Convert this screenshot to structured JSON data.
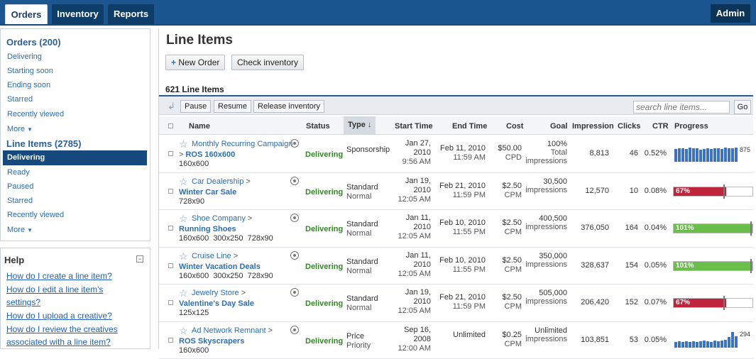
{
  "nav": {
    "tabs": [
      "Orders",
      "Inventory",
      "Reports"
    ],
    "admin": "Admin"
  },
  "sidebar": {
    "orders_header": "Orders (200)",
    "orders_items": [
      "Delivering",
      "Starting soon",
      "Ending soon",
      "Starred",
      "Recently viewed",
      "More"
    ],
    "line_items_header": "Line Items (2785)",
    "line_items_items": [
      "Delivering",
      "Ready",
      "Paused",
      "Starred",
      "Recently viewed",
      "More"
    ],
    "selected": "Delivering"
  },
  "help": {
    "title": "Help",
    "collapse": "−",
    "questions": [
      "How do I create a line item?",
      "How do I edit a line item's",
      "settings?",
      "How do I upload a creative?",
      "How do I review the creatives",
      "associated with a line item?"
    ]
  },
  "main": {
    "title": "Line Items",
    "new_order": "New Order",
    "new_order_icon": "+",
    "check_inventory": "Check inventory",
    "count_label": "621 Line Items",
    "toolbar": {
      "pause": "Pause",
      "resume": "Resume",
      "release": "Release inventory",
      "search_placeholder": "search line items...",
      "go": "Go"
    },
    "columns": {
      "name": "Name",
      "status": "Status",
      "type": "Type ↓",
      "start": "Start Time",
      "end": "End Time",
      "cost": "Cost",
      "goal": "Goal",
      "impression": "Impression",
      "clicks": "Clicks",
      "ctr": "CTR",
      "progress": "Progress"
    }
  },
  "rows": [
    {
      "advertiser": "Monthly Recurring Campaign",
      "prefix": "> ",
      "name": "ROS 160x600",
      "sizes": "160x600",
      "status": "Delivering",
      "type1": "Sponsorship",
      "type2": "",
      "start1": "Jan 27,",
      "start2": "2010",
      "start3": "9:56 AM",
      "end1": "Feb 11, 2010",
      "end2": "11:59 AM",
      "cost1": "$50.00",
      "cost2": "CPD",
      "goal1": "100%",
      "goal2": "Total",
      "goal3": "impressions",
      "impressions": "8,813",
      "clicks": "46",
      "ctr": "0.52%",
      "progress": {
        "kind": "spark",
        "label": "875",
        "bars": [
          0.75,
          0.8,
          0.8,
          0.75,
          0.85,
          0.8,
          0.8,
          0.7,
          0.75,
          0.8,
          0.75,
          0.8,
          0.8,
          0.75,
          0.85,
          0.8,
          0.8,
          0.85
        ]
      }
    },
    {
      "advertiser": "Car Dealership",
      "prefix": "",
      "advertiser_suffix": " >",
      "name": "Winter Car Sale",
      "sizes": "728x90",
      "status": "Delivering",
      "type1": "Standard",
      "type2": "Normal",
      "start1": "Jan 19,",
      "start2": "2010",
      "start3": "12:05 AM",
      "end1": "Feb 21, 2010",
      "end2": "11:59 PM",
      "cost1": "$2.50",
      "cost2": "CPM",
      "goal1": "30,500",
      "goal2": "impressions",
      "goal3": "",
      "impressions": "12,570",
      "clicks": "10",
      "ctr": "0.08%",
      "progress": {
        "kind": "bar",
        "label": "67%",
        "value": 0.67,
        "mark": 0.63,
        "color": "#c0243c"
      }
    },
    {
      "advertiser": "Shoe Company",
      "prefix": "",
      "advertiser_suffix": " >",
      "name": "Running Shoes",
      "sizes": "160x600  300x250  728x90",
      "status": "Delivering",
      "type1": "Standard",
      "type2": "Normal",
      "start1": "Jan 11,",
      "start2": "2010",
      "start3": "12:05 AM",
      "end1": "Feb 10, 2010",
      "end2": "11:55 PM",
      "cost1": "$2.50",
      "cost2": "CPM",
      "goal1": "400,500",
      "goal2": "impressions",
      "goal3": "",
      "impressions": "376,050",
      "clicks": "164",
      "ctr": "0.04%",
      "progress": {
        "kind": "bar",
        "label": "101%",
        "value": 1.0,
        "mark": 0.97,
        "color": "#6abf4b"
      }
    },
    {
      "advertiser": "Cruise Line",
      "prefix": "",
      "advertiser_suffix": " >",
      "name": "Winter Vacation Deals",
      "sizes": "160x600  300x250  728x90",
      "status": "Delivering",
      "type1": "Standard",
      "type2": "Normal",
      "start1": "Jan 11,",
      "start2": "2010",
      "start3": "12:05 AM",
      "end1": "Feb 10, 2010",
      "end2": "11:55 PM",
      "cost1": "$2.50",
      "cost2": "CPM",
      "goal1": "350,000",
      "goal2": "impressions",
      "goal3": "",
      "impressions": "328,637",
      "clicks": "154",
      "ctr": "0.05%",
      "progress": {
        "kind": "bar",
        "label": "101%",
        "value": 1.0,
        "mark": 0.97,
        "color": "#6abf4b"
      }
    },
    {
      "advertiser": "Jewelry Store",
      "prefix": "",
      "advertiser_suffix": " >",
      "name": "Valentine's Day Sale",
      "sizes": "125x125",
      "status": "Delivering",
      "type1": "Standard",
      "type2": "Normal",
      "start1": "Jan 19,",
      "start2": "2010",
      "start3": "12:05 AM",
      "end1": "Feb 21, 2010",
      "end2": "11:59 PM",
      "cost1": "$2.50",
      "cost2": "CPM",
      "goal1": "505,000",
      "goal2": "impressions",
      "goal3": "",
      "impressions": "206,420",
      "clicks": "152",
      "ctr": "0.07%",
      "progress": {
        "kind": "bar",
        "label": "67%",
        "value": 0.67,
        "mark": 0.63,
        "color": "#c0243c"
      }
    },
    {
      "advertiser": "Ad Network Remnant",
      "prefix": "",
      "advertiser_suffix": " >",
      "name": "ROS Skyscrapers",
      "sizes": "160x600",
      "status": "Delivering",
      "type1": "Price",
      "type2": "Priority",
      "start1": "Sep 16,",
      "start2": "2008",
      "start3": "12:00 AM",
      "end1": "Unlimited",
      "end2": "",
      "cost1": "$0.25",
      "cost2": "CPM",
      "goal1": "Unlimited",
      "goal2": "impressions",
      "goal3": "",
      "impressions": "103,851",
      "clicks": "53",
      "ctr": "0.05%",
      "progress": {
        "kind": "spark",
        "label": "294",
        "bars": [
          0.3,
          0.35,
          0.3,
          0.35,
          0.3,
          0.35,
          0.3,
          0.35,
          0.4,
          0.35,
          0.3,
          0.4,
          0.35,
          0.4,
          0.45,
          0.6,
          0.9,
          0.65
        ]
      }
    }
  ],
  "colors": {
    "nav": "#1b5690",
    "link": "#2c6db3",
    "delivering": "#2e8b1e"
  }
}
